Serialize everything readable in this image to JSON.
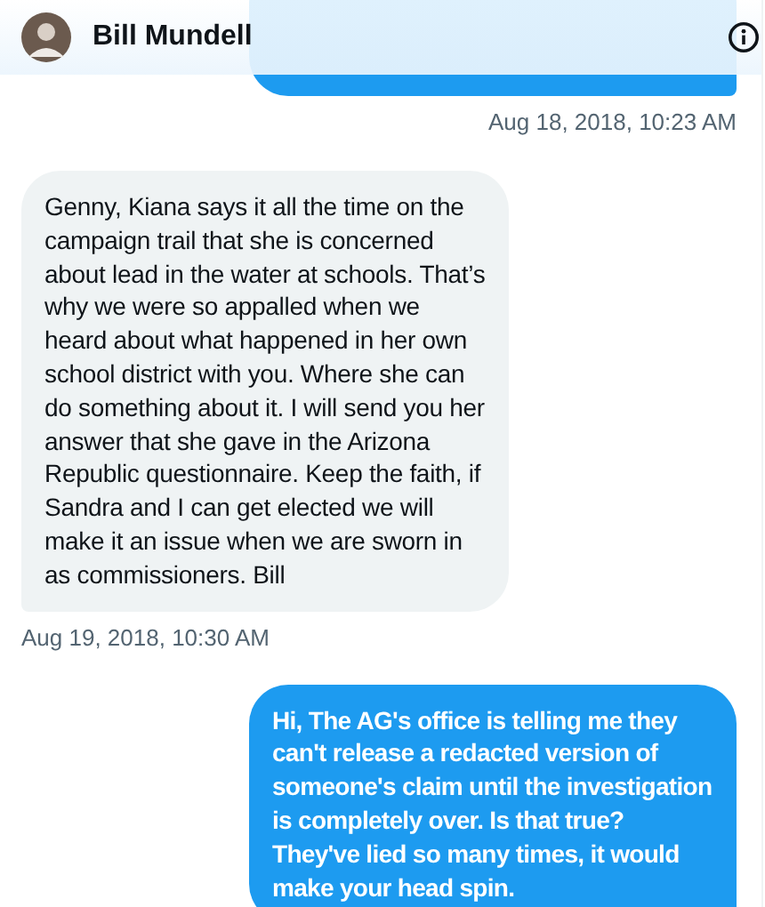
{
  "header": {
    "name": "Bill Mundell"
  },
  "messages": [
    {
      "kind": "sent",
      "time": "Aug 18, 2018, 10:23 AM"
    },
    {
      "kind": "received",
      "text": "Genny, Kiana says it all the time on the campaign trail that she is concerned about lead in the water at schools. That’s why we were so appalled when we heard about what happened in her own school district with you.  Where she can do something about it.  I will send you her answer that she gave in the Arizona Republic questionnaire. Keep the faith, if Sandra and I can get elected we will make it an issue when we are sworn in as commissioners. Bill",
      "time": "Aug 19, 2018, 10:30 AM"
    },
    {
      "kind": "sent",
      "text": "Hi, The AG's office is telling me they can't release a redacted version of someone's claim until the investigation is completely over. Is that true? They've lied so many times, it would make your head spin."
    }
  ]
}
